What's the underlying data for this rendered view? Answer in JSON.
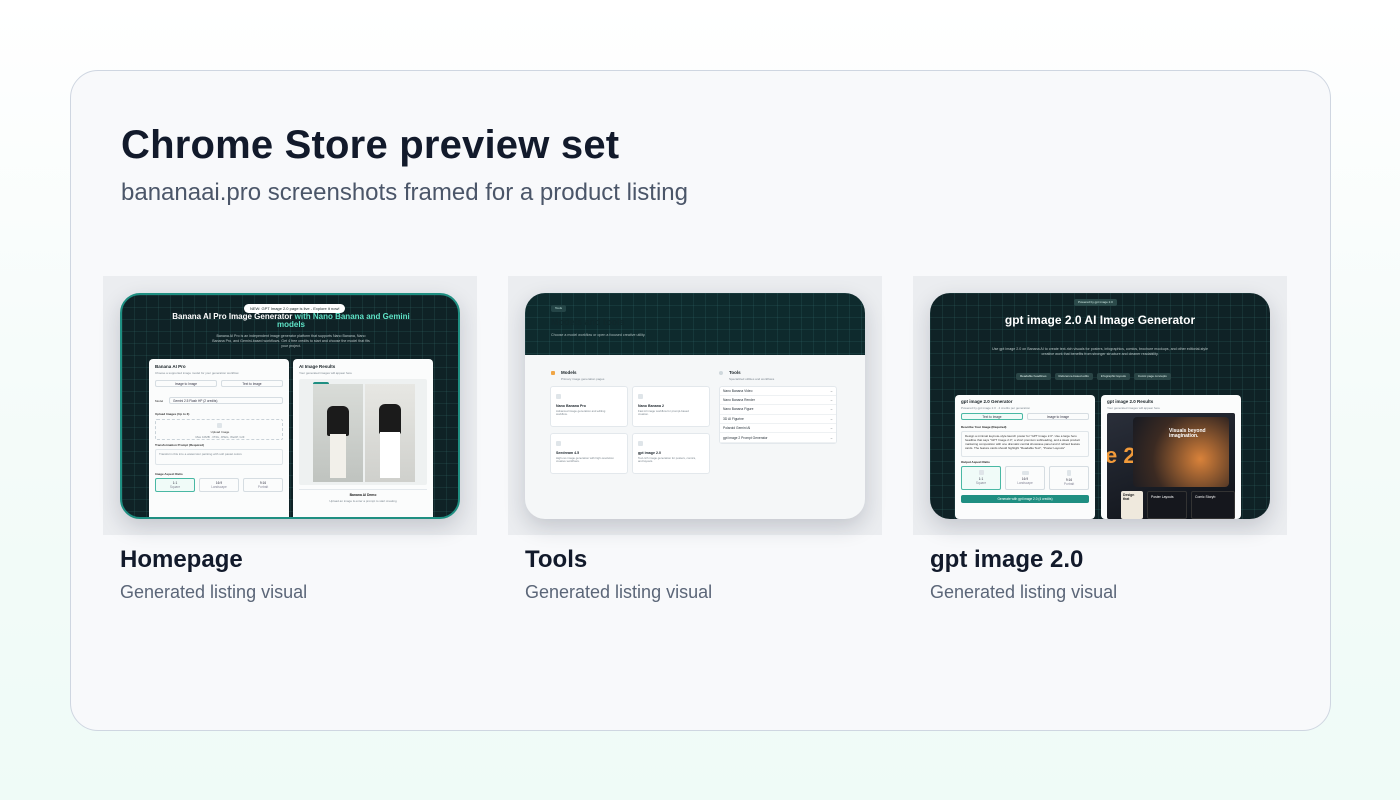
{
  "page": {
    "title": "Chrome Store preview set",
    "subtitle": "bananaai.pro screenshots framed for a product listing"
  },
  "cards": [
    {
      "title": "Homepage",
      "caption": "Generated listing visual",
      "shot": {
        "badge": "NEW: GPT Image 2.0 page is live - Explore it now!",
        "hero_title_a": "Banana AI Pro Image Generator ",
        "hero_title_b": "with Nano Banana and Gemini models",
        "hero_text": "Banana AI Pro is an independent image generator platform that supports Nano Banana, Nano Banana Pro, and Gemini-based workflows. Get 4 free credits to start and choose the model that fits your project.",
        "left_panel_title": "Banana AI Pro",
        "left_panel_sub": "Choose a supported image model for your generation workflow",
        "tab_a": "Image to Image",
        "tab_b": "Text to Image",
        "model_label": "Model",
        "model_value": "Gemini 2.5 Flash HP (2 credits)",
        "upload_label": "Upload Images (Up to 3)",
        "upload_box": "Upload Image",
        "upload_hint": "Max 10MB · PNG, JPEG, WebP, GIF",
        "prompt_label": "Transformation Prompt (Required)",
        "prompt_placeholder": "Transform this into a watercolor painting with soft pastel colors",
        "ratio_label": "Image Aspect Ratio",
        "ratios": [
          "1:1",
          "16:9",
          "9:16"
        ],
        "ratio_names": [
          "Square",
          "Landscape",
          "Portrait"
        ],
        "right_panel_title": "AI Image Results",
        "right_panel_sub": "Your generated images will appear here",
        "demo_chip": "Demo",
        "demo_title": "Banana AI Demo",
        "demo_sub": "Upload an image & enter a prompt to start creating"
      }
    },
    {
      "title": "Tools",
      "caption": "Generated listing visual",
      "shot": {
        "chip": "Tools",
        "hero_title": "Models and tools",
        "hero_text": "Choose a model workflow or open a focused creative utility.",
        "models_title": "Models",
        "models_sub": "Primary image generation pages",
        "tools_title": "Tools",
        "tools_sub": "Specialized utilities and workflows",
        "models": [
          {
            "name": "Nano Banana Pro",
            "desc": "Advanced image generation and editing workflow."
          },
          {
            "name": "Nano Banana 2",
            "desc": "Fast AI image workflow for prompt-based creation."
          },
          {
            "name": "Seedream 4.5",
            "desc": "High-res image generation with high-resolution creative workflows."
          },
          {
            "name": "gpt image 2.0",
            "desc": "Text-rich image generation for posters, comics, and layouts."
          }
        ],
        "tools": [
          "Nano Banana Video",
          "Nano Banana Render",
          "Nano Banana Figure",
          "3D AI Figurine",
          "Polaroid Gemini AI",
          "gpt image 2 Prompt Generator"
        ]
      }
    },
    {
      "title": "gpt image 2.0",
      "caption": "Generated listing visual",
      "shot": {
        "badge": "Powered by gpt image 2.0",
        "hero_title": "gpt image 2.0 AI Image Generator",
        "hero_text": "Use gpt image 2.0 on Banana AI to create text-rich visuals for posters, infographics, comics, brochure mockups, and other editorial-style creative work that benefits from stronger structure and cleaner readability.",
        "chips": [
          "Readable headlines",
          "Reference-based edits",
          "Infographic layouts",
          "Comic page concepts"
        ],
        "left_panel_title": "gpt image 2.0 Generator",
        "left_panel_sub": "Powered by gpt image 2.0 · 4 credits per generation",
        "tab_a": "Text to Image",
        "tab_b": "Image to Image",
        "describe_label": "Describe Your Image (Required)",
        "describe_text": "Design a minimal keynote-style launch poster for \"GPT Image 2.0\". Use a large hero headline that says \"GPT Image 2.0\", a short premium subheading, and a sleek product marketing composition with one dramatic central showcase panel and 2 refined feature cards. The feature cards should highlight \"Readable Text\", \"Poster Layouts\"",
        "ratio_label": "Output Aspect Ratio",
        "ratios": [
          "1:1",
          "16:9",
          "9:16"
        ],
        "ratio_names": [
          "Square",
          "Landscape",
          "Portrait"
        ],
        "generate_button": "Generate with gpt image 2.0 (4 credits)",
        "right_panel_title": "gpt image 2.0 Results",
        "right_panel_sub": "Your generated images will appear here",
        "poster_big_text": "e 2",
        "poster_headline": "Visuals beyond imagination.",
        "poster_card_a": "Design that",
        "poster_card_b": "Poster Layouts",
        "poster_card_c": "Comic Storyb"
      }
    }
  ],
  "colors": {
    "accent_teal": "#1f8f82",
    "dark_bg": "#0f2226",
    "title": "#121a2b",
    "subtitle": "#4b5669"
  }
}
